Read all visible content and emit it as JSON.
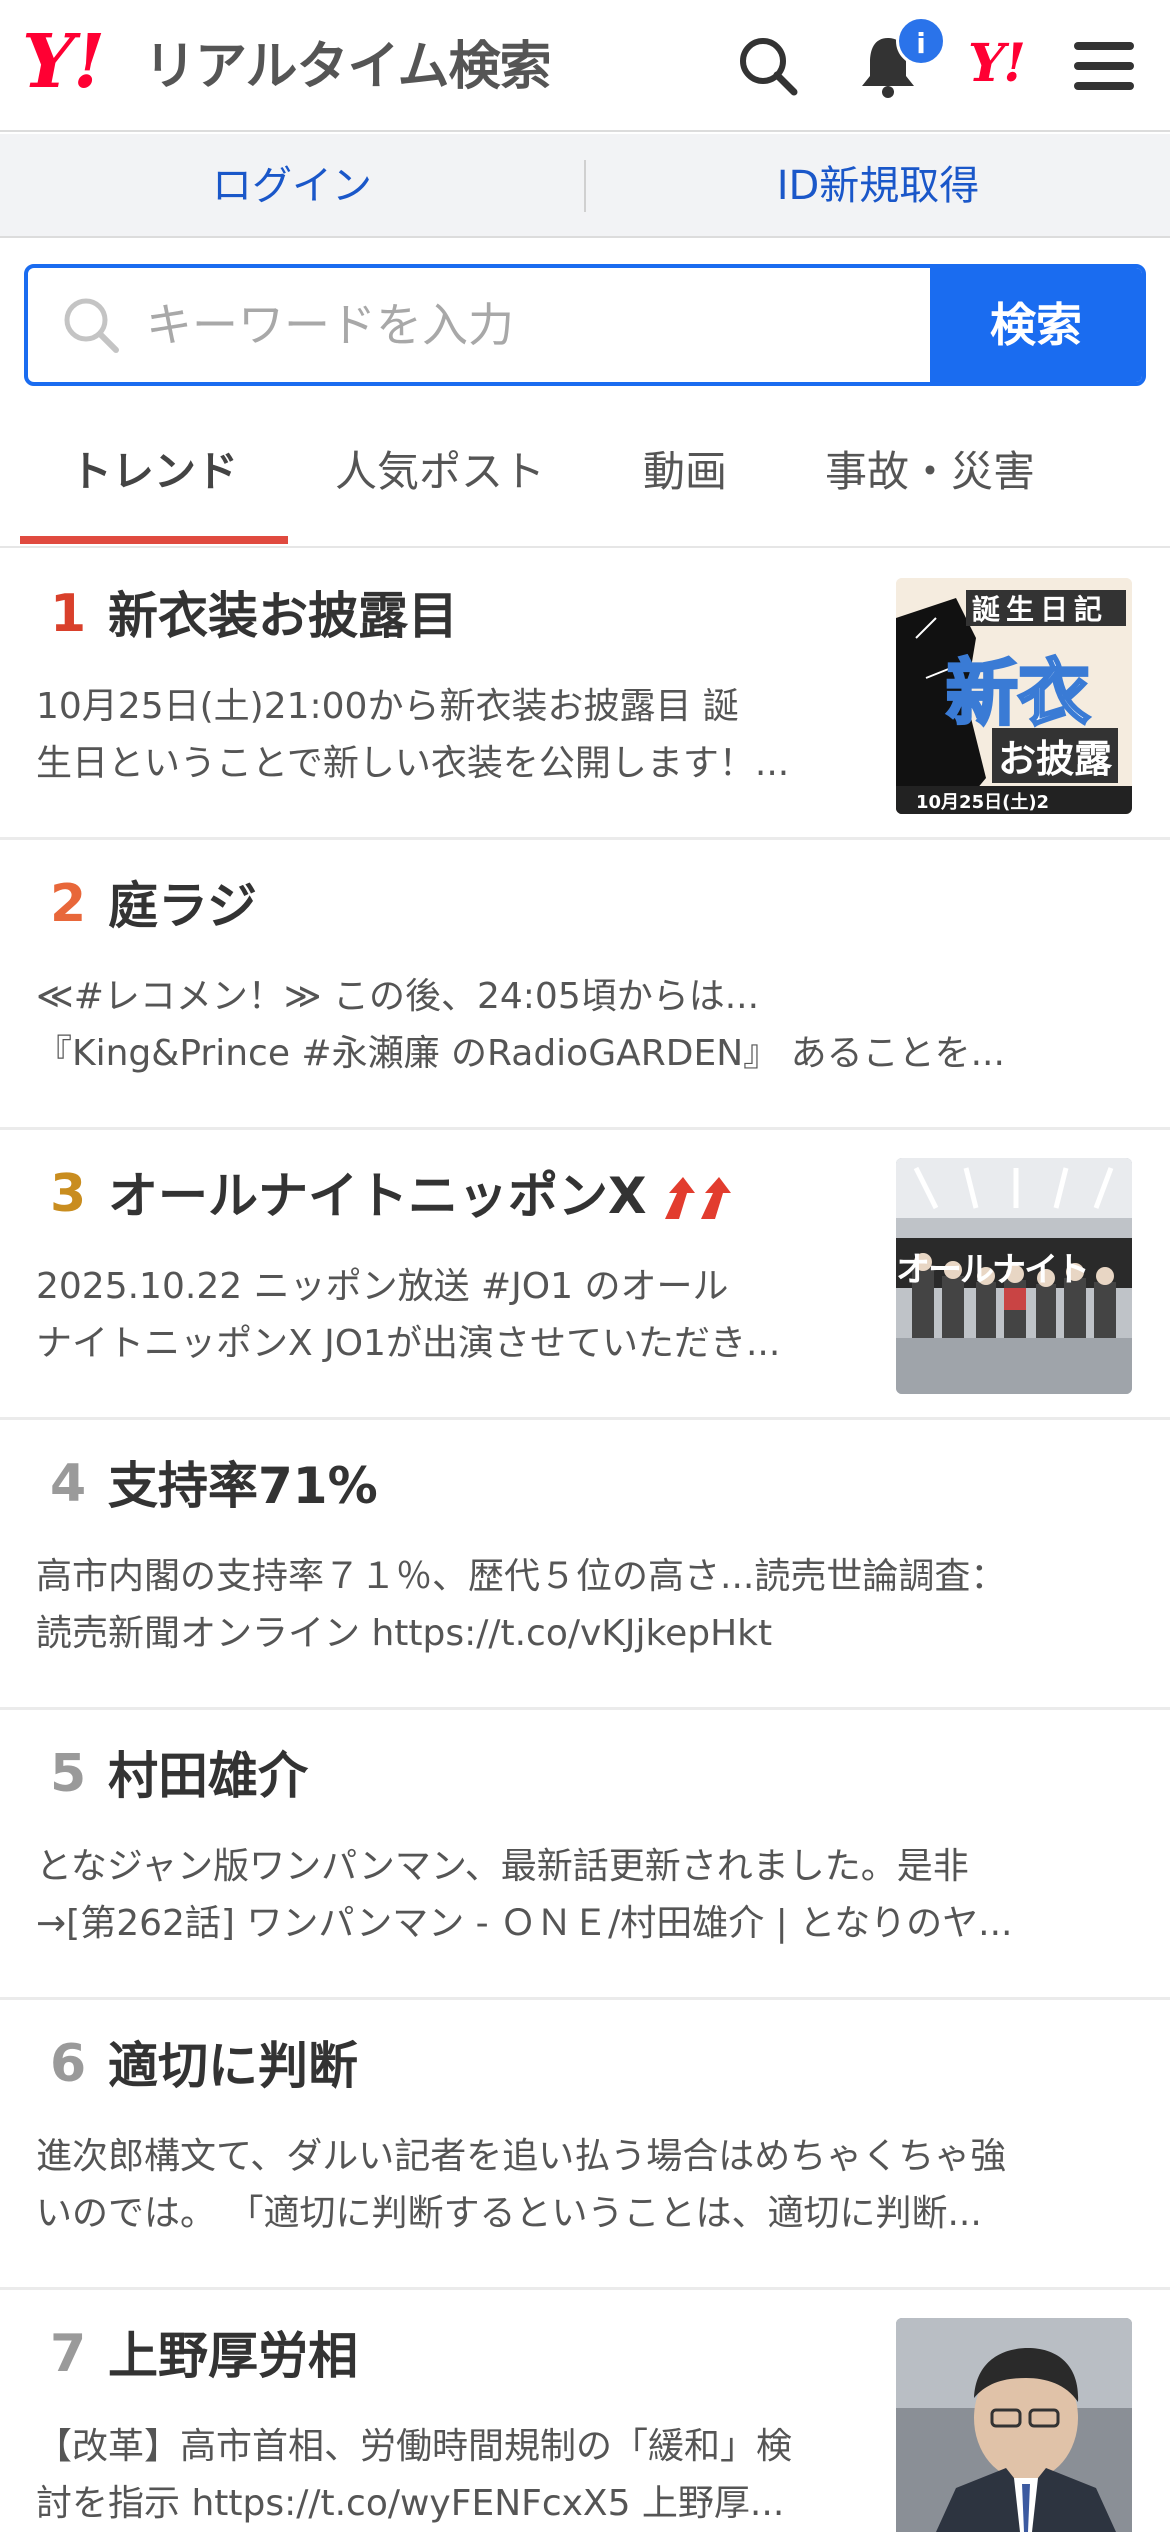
{
  "header": {
    "logo_mark": "Y!",
    "logo_text": "リアルタイム検索",
    "notification_badge": "i",
    "yj_logo": "Y!"
  },
  "login_bar": {
    "login": "ログイン",
    "register": "ID新規取得"
  },
  "search": {
    "placeholder": "キーワードを入力",
    "button": "検索"
  },
  "tabs": [
    {
      "label": "トレンド",
      "active": true
    },
    {
      "label": "人気ポスト",
      "active": false
    },
    {
      "label": "動画",
      "active": false
    },
    {
      "label": "事故・災害",
      "active": false
    }
  ],
  "colors": {
    "accent_blue": "#1a6cf0",
    "rank1": "#d9402b",
    "rank2": "#e8673a",
    "rank3": "#c98d1f",
    "rank_other": "#9a9a9a",
    "up_arrow": "#e23c2e"
  },
  "trends": [
    {
      "rank": "1",
      "title": "新衣装お披露目",
      "desc1": "10月25日(土)21:00から新衣装お披露目 誕",
      "desc2": "生日ということで新しい衣装を公開します！...",
      "thumb_caption_top": "誕生日記",
      "thumb_caption_main": "新衣",
      "thumb_caption_sub": "お披露",
      "thumb_caption_date": "10月25日(土)2"
    },
    {
      "rank": "2",
      "title": "庭ラジ",
      "desc1": "≪#レコメン！≫ この後、24:05頃からは...",
      "desc2": "『King&Prince #永瀬廉 のRadioGARDEN』 あることを..."
    },
    {
      "rank": "3",
      "title": "オールナイトニッポンX",
      "rising_icon": "double-up-arrow-icon",
      "desc1": "2025.10.22  ニッポン放送 #JO1 のオール",
      "desc2": "ナイトニッポンX JO1が出演させていただき...",
      "thumb_caption": "オールナイト"
    },
    {
      "rank": "4",
      "title": "支持率71%",
      "desc1": "高市内閣の支持率７１％、歴代５位の高さ...読売世論調査：",
      "desc2": "読売新聞オンライン https://t.co/vKJjkepHkt"
    },
    {
      "rank": "5",
      "title": "村田雄介",
      "desc1": "となジャン版ワンパンマン、最新話更新されました。是非",
      "desc2": "→[第262話] ワンパンマン - ＯＮＥ/村田雄介 | となりのヤ..."
    },
    {
      "rank": "6",
      "title": "適切に判断",
      "desc1": "進次郎構文て、ダルい記者を追い払う場合はめちゃくちゃ強",
      "desc2": "いのでは。 「適切に判断するということは、適切に判断..."
    },
    {
      "rank": "7",
      "title": "上野厚労相",
      "desc1": "【改革】高市首相、労働時間規制の「緩和」検",
      "desc2": "討を指示 https://t.co/wyFENFcxX5 上野厚..."
    }
  ]
}
